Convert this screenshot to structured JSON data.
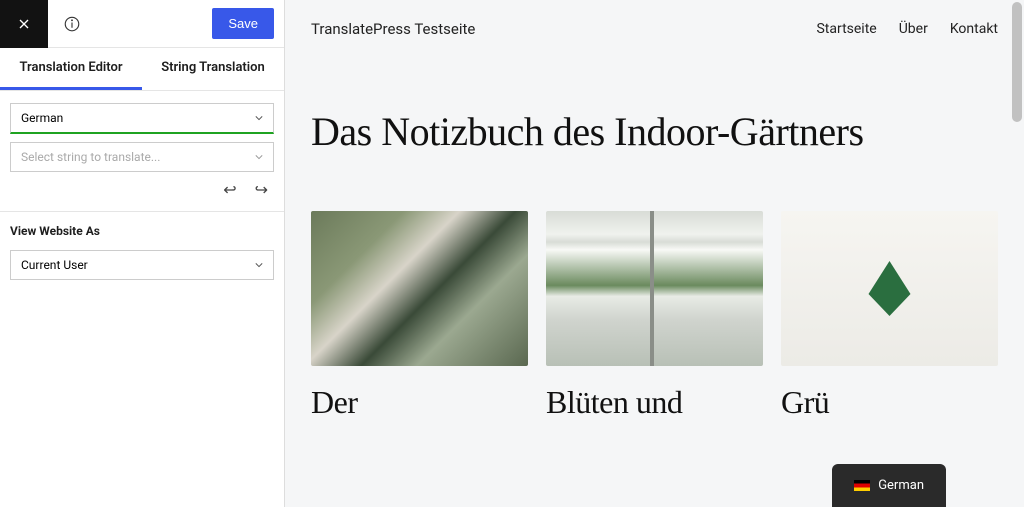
{
  "topbar": {
    "save_label": "Save"
  },
  "tabs": {
    "editor": "Translation Editor",
    "string": "String Translation"
  },
  "controls": {
    "language_selected": "German",
    "string_placeholder": "Select string to translate..."
  },
  "view_as": {
    "label": "View Website As",
    "selected": "Current User"
  },
  "site": {
    "title": "TranslatePress Testseite",
    "nav": [
      "Startseite",
      "Über",
      "Kontakt"
    ],
    "heading": "Das Notizbuch des Indoor-Gärtners",
    "cards": [
      {
        "title": "Der"
      },
      {
        "title": "Blüten und"
      },
      {
        "title": "Grü"
      }
    ]
  },
  "switcher": {
    "label": "German"
  }
}
